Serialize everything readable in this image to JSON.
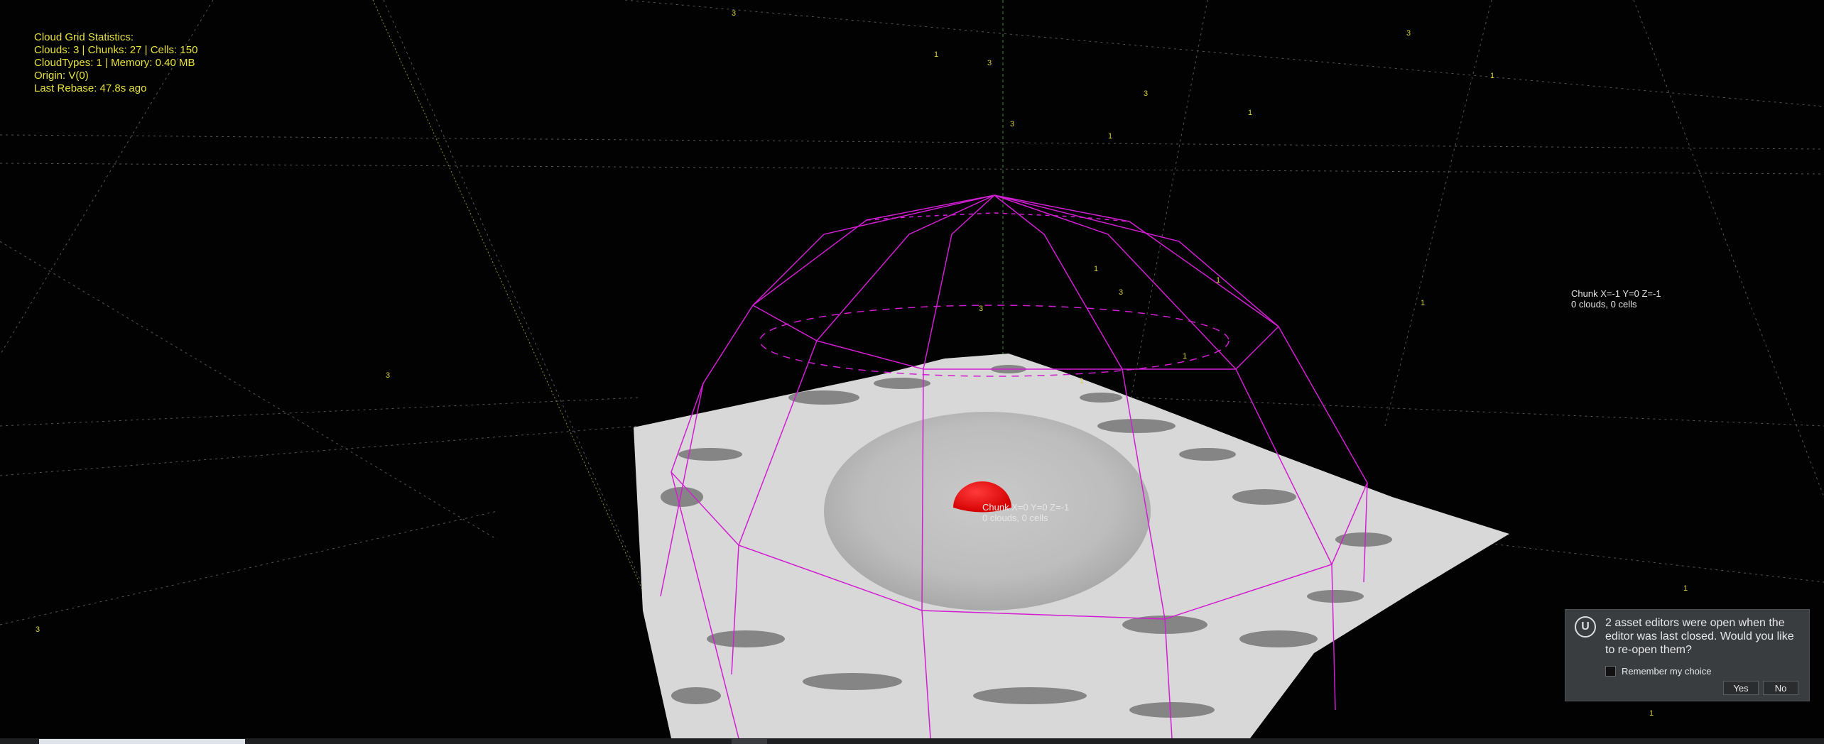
{
  "overlay": {
    "stats": [
      "Cloud Grid Statistics:",
      "Clouds: 3 | Chunks: 27 | Cells: 150",
      "CloudTypes: 1 | Memory: 0.40 MB",
      "Origin: V(0)",
      "Last Rebase: 47.8s ago"
    ]
  },
  "chunk_labels": {
    "right": {
      "line1": "Chunk X=-1 Y=0 Z=-1",
      "line2": "0 clouds, 0 cells"
    },
    "center": {
      "line1": "Chunk X=0 Y=0 Z=-1",
      "line2": "0 clouds, 0 cells"
    }
  },
  "cell_markers": [
    "3",
    "1",
    "3",
    "1",
    "3",
    "1",
    "3",
    "1",
    "3",
    "1",
    "3",
    "1",
    "3",
    "1",
    "1",
    "3",
    "1",
    "1",
    "3",
    "1"
  ],
  "notification": {
    "message": "2 asset editors were open when the editor was last closed. Would you like to re-open them?",
    "remember_label": "Remember my choice",
    "yes_label": "Yes",
    "no_label": "No",
    "logo_icon": "unreal-logo-icon"
  },
  "colors": {
    "stats_text": "#e8e23c",
    "wireframe": "#d21ed2",
    "sphere": "#ff0000",
    "toast_bg": "#3a3d40"
  }
}
